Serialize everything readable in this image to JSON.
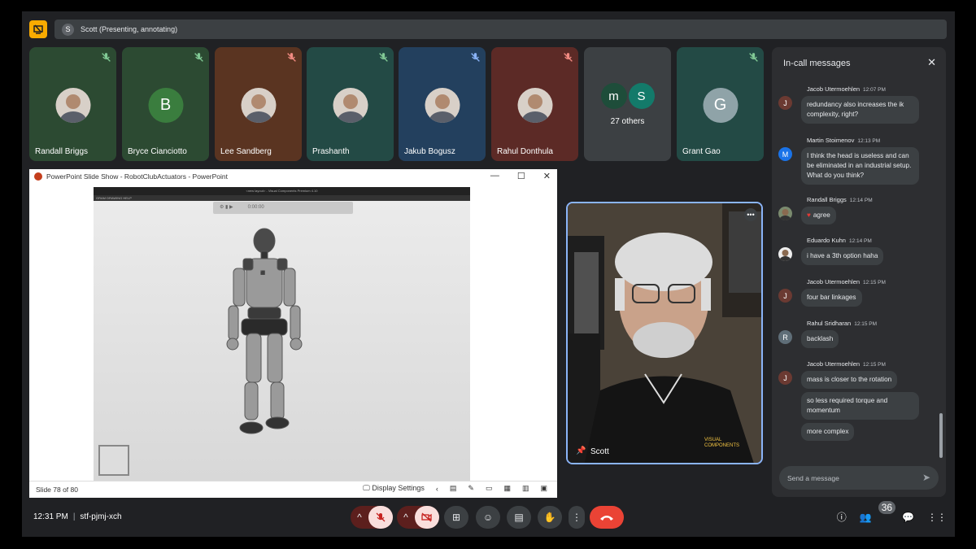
{
  "presenter_bar": {
    "avatar_letter": "S",
    "text": "Scott (Presenting, annotating)"
  },
  "tiles": [
    {
      "name": "Randall Briggs",
      "bg": "#2c4a32",
      "avatar_type": "photo",
      "mute_color": "#81c995"
    },
    {
      "name": "Bryce Cianciotto",
      "bg": "#2c4a32",
      "avatar_letter": "B",
      "avatar_bg": "#3a7d3e",
      "mute_color": "#81c995"
    },
    {
      "name": "Lee Sandberg",
      "bg": "#5a3421",
      "avatar_type": "photo",
      "mute_color": "#f28b82"
    },
    {
      "name": "Prashanth",
      "bg": "#234a45",
      "avatar_type": "photo",
      "mute_color": "#81c995"
    },
    {
      "name": "Jakub Bogusz",
      "bg": "#23405e",
      "avatar_type": "photo",
      "mute_color": "#8ab4f8"
    },
    {
      "name": "Rahul Donthula",
      "bg": "#5c2a26",
      "avatar_type": "photo",
      "mute_color": "#f28b82"
    },
    {
      "name": "",
      "bg": "#3c4043",
      "others": true,
      "others_letters": [
        "m",
        "S"
      ],
      "others_text": "27 others"
    },
    {
      "name": "Grant Gao",
      "bg": "#234a45",
      "avatar_letter": "G",
      "avatar_bg": "#8fa3a8",
      "mute_color": "#81c995"
    }
  ],
  "ppt": {
    "title": "PowerPoint Slide Show  -  RobotClubActuators - PowerPoint",
    "controls": {
      "minimize": "—",
      "maximize": "☐",
      "close": "✕"
    },
    "slide_app_title": "<new layout> - Visual Components Premium 4.10",
    "slide_menu": "GRAM     DRAWING     HELP",
    "slide_toolbar_text": "0:00:00",
    "slide_counter": "Slide 78 of 80",
    "display_settings": "Display Settings"
  },
  "video": {
    "name": "Scott",
    "shirt_text": "VISUAL COMPONENTS"
  },
  "chat": {
    "title": "In-call messages",
    "close": "✕",
    "messages": [
      {
        "sender": "Jacob Utermoehlen",
        "time": "12:07 PM",
        "avatar_letter": "J",
        "avatar_bg": "#6b3a32",
        "texts": [
          "redundancy also increases the ik complexity, right?"
        ]
      },
      {
        "sender": "Martin Stoimenov",
        "time": "12:13 PM",
        "avatar_letter": "M",
        "avatar_bg": "#1a73e8",
        "texts": [
          "I think the head is useless and can be eliminated in an industrial setup. What do you think?"
        ]
      },
      {
        "sender": "Randall Briggs",
        "time": "12:14 PM",
        "avatar_letter": "",
        "avatar_bg": "#7a8a6e",
        "texts": [
          "agree"
        ],
        "heart": "♥"
      },
      {
        "sender": "Eduardo Kuhn",
        "time": "12:14 PM",
        "avatar_letter": "",
        "avatar_bg": "#eee",
        "texts": [
          "i have a 3th option haha"
        ]
      },
      {
        "sender": "Jacob Utermoehlen",
        "time": "12:15 PM",
        "avatar_letter": "J",
        "avatar_bg": "#6b3a32",
        "texts": [
          "four bar linkages"
        ]
      },
      {
        "sender": "Rahul Sridharan",
        "time": "12:15 PM",
        "avatar_letter": "R",
        "avatar_bg": "#5f6e78",
        "texts": [
          "backlash"
        ]
      },
      {
        "sender": "Jacob Utermoehlen",
        "time": "12:15 PM",
        "avatar_letter": "J",
        "avatar_bg": "#6b3a32",
        "texts": [
          "mass is closer to the rotation",
          "so less required torque and momentum",
          "more complex"
        ]
      }
    ],
    "input_placeholder": "Send a message"
  },
  "bottom": {
    "time": "12:31 PM",
    "separator": "|",
    "meeting_code": "stf-pjmj-xch",
    "people_count": "36"
  }
}
